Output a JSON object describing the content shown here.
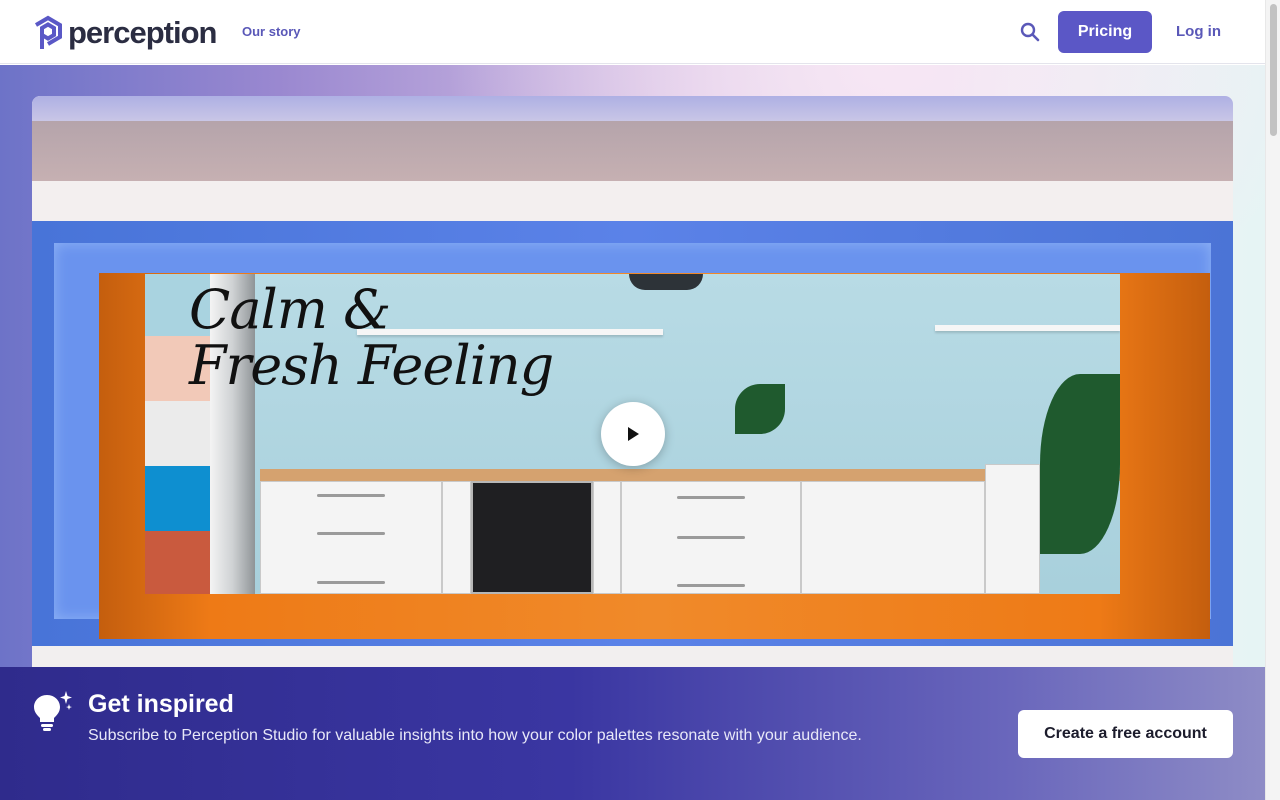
{
  "header": {
    "logo_text": "perception",
    "nav_our_story": "Our story",
    "pricing_label": "Pricing",
    "login_label": "Log in",
    "search_icon": "search-icon"
  },
  "hero": {
    "headline_line1": "Calm &",
    "headline_line2": "Fresh Feeling",
    "play_icon": "play-icon",
    "palette_colors": [
      "#f2c9b8",
      "#ebebeb",
      "#0e8fd0",
      "#c95a3e"
    ]
  },
  "banner": {
    "title": "Get inspired",
    "text": "Subscribe to Perception Studio for valuable insights into how your color palettes resonate with your audience.",
    "cta_label": "Create a free account",
    "icon": "lightbulb-sparkle-icon"
  },
  "colors": {
    "brand": "#5b57c6",
    "banner_dark": "#2f2b8c"
  }
}
